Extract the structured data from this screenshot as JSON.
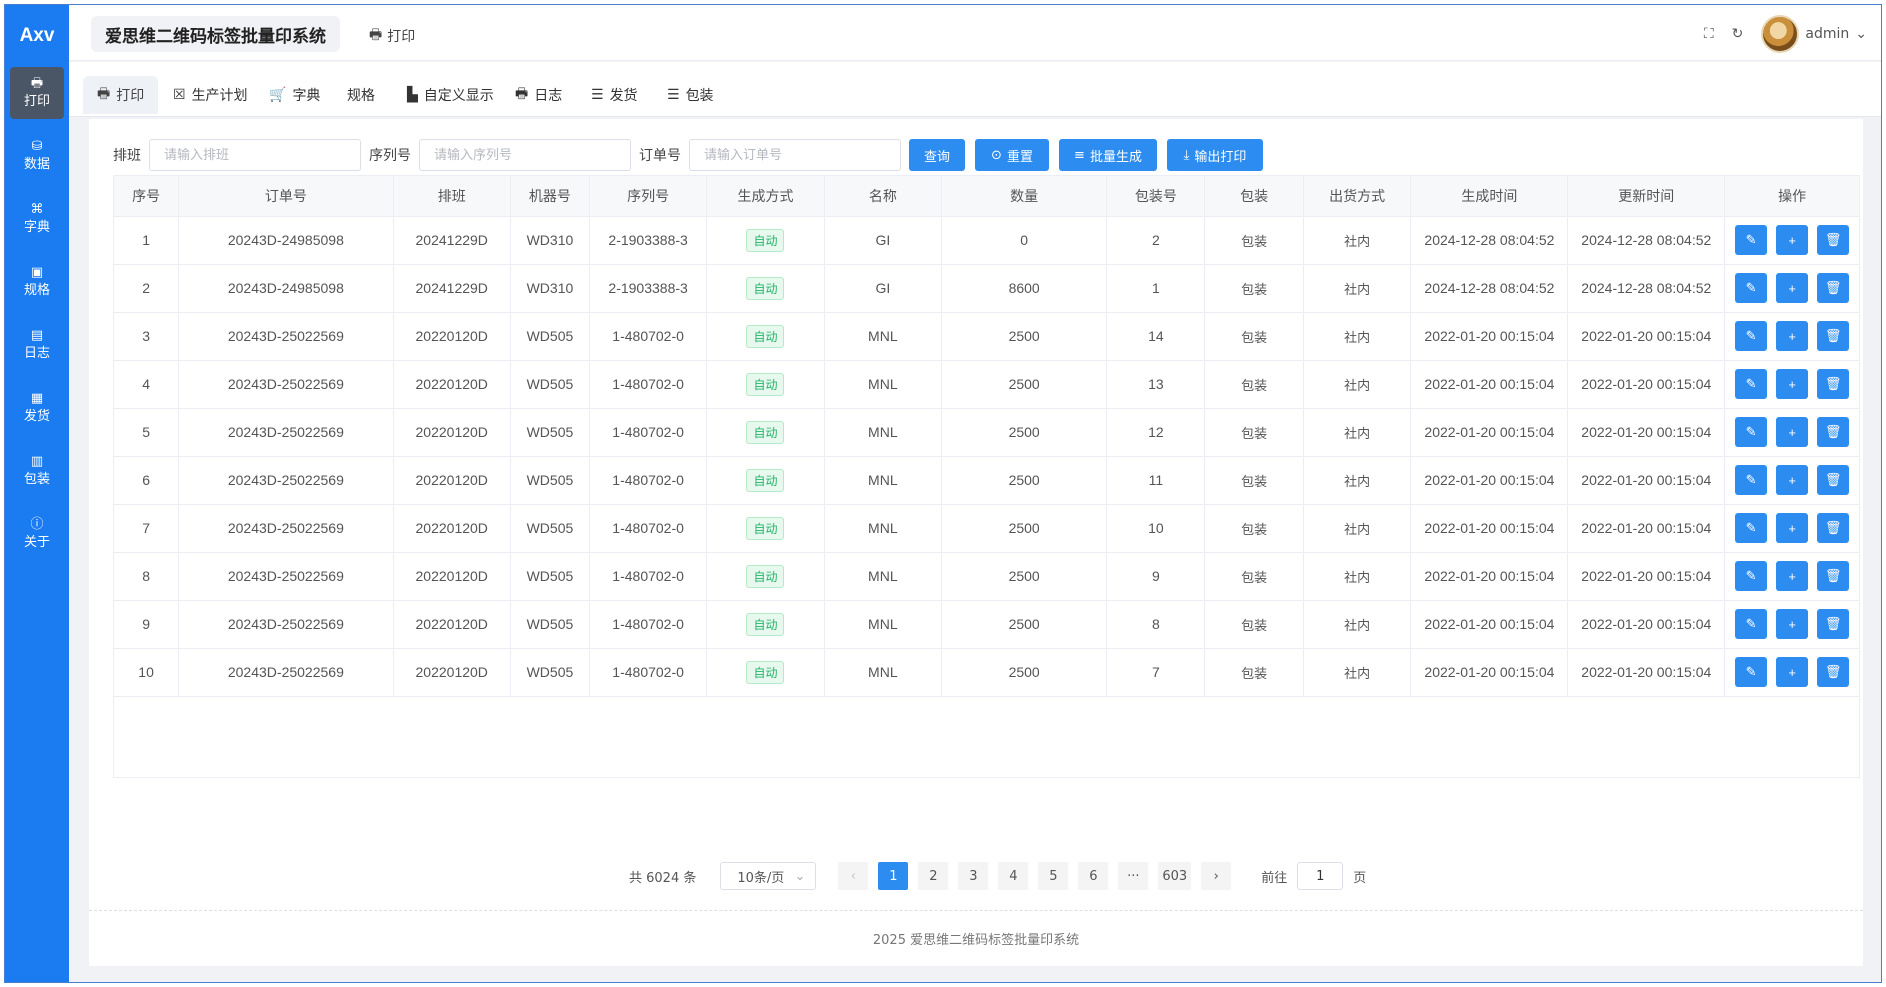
{
  "sidebar": {
    "logo": "Axv",
    "items": [
      {
        "icon": "🖶",
        "label": "打印"
      },
      {
        "icon": "⛁",
        "label": "数据"
      },
      {
        "icon": "⌘",
        "label": "字典"
      },
      {
        "icon": "▣",
        "label": "规格"
      },
      {
        "icon": "▤",
        "label": "日志"
      },
      {
        "icon": "▦",
        "label": "发货"
      },
      {
        "icon": "▥",
        "label": "包装"
      },
      {
        "icon": "ⓘ",
        "label": "关于"
      }
    ]
  },
  "header": {
    "title": "爱思维二维码标签批量印系统",
    "print_label": "打印",
    "print_icon": "🖶",
    "fullscreen_icon": "⛶",
    "refresh_icon": "↻",
    "user": "admin",
    "chevron": "⌄"
  },
  "tabs": [
    {
      "icon": "🖶",
      "label": "打印"
    },
    {
      "icon": "☒",
      "label": "生产计划"
    },
    {
      "icon": "🛒",
      "label": "字典"
    },
    {
      "icon": "",
      "label": "规格"
    },
    {
      "icon": "▙",
      "label": "自定义显示"
    },
    {
      "icon": "🖶",
      "label": "日志"
    },
    {
      "icon": "☰",
      "label": "发货"
    },
    {
      "icon": "☰",
      "label": "包装"
    }
  ],
  "search": {
    "shift_label": "排班",
    "shift_placeholder": "请输入排班",
    "serial_label": "序列号",
    "serial_placeholder": "请输入序列号",
    "order_label": "订单号",
    "order_placeholder": "请输入订单号",
    "query_btn": "查询",
    "reset_btn": "重置",
    "batch_btn": "批量生成",
    "export_btn": "输出打印",
    "reset_icon": "⊙",
    "batch_icon": "≡",
    "export_icon": "⤓"
  },
  "table": {
    "headers": [
      "序号",
      "订单号",
      "排班",
      "机器号",
      "序列号",
      "生成方式",
      "名称",
      "数量",
      "包装号",
      "包装",
      "出货方式",
      "生成时间",
      "更新时间",
      "操作"
    ],
    "rows": [
      [
        "1",
        "20243D-24985098",
        "20241229D",
        "WD310",
        "2-1903388-3",
        "自动",
        "GI",
        "0",
        "2",
        "包装",
        "社内",
        "2024-12-28 08:04:52",
        "2024-12-28 08:04:52"
      ],
      [
        "2",
        "20243D-24985098",
        "20241229D",
        "WD310",
        "2-1903388-3",
        "自动",
        "GI",
        "8600",
        "1",
        "包装",
        "社内",
        "2024-12-28 08:04:52",
        "2024-12-28 08:04:52"
      ],
      [
        "3",
        "20243D-25022569",
        "20220120D",
        "WD505",
        "1-480702-0",
        "自动",
        "MNL",
        "2500",
        "14",
        "包装",
        "社内",
        "2022-01-20 00:15:04",
        "2022-01-20 00:15:04"
      ],
      [
        "4",
        "20243D-25022569",
        "20220120D",
        "WD505",
        "1-480702-0",
        "自动",
        "MNL",
        "2500",
        "13",
        "包装",
        "社内",
        "2022-01-20 00:15:04",
        "2022-01-20 00:15:04"
      ],
      [
        "5",
        "20243D-25022569",
        "20220120D",
        "WD505",
        "1-480702-0",
        "自动",
        "MNL",
        "2500",
        "12",
        "包装",
        "社内",
        "2022-01-20 00:15:04",
        "2022-01-20 00:15:04"
      ],
      [
        "6",
        "20243D-25022569",
        "20220120D",
        "WD505",
        "1-480702-0",
        "自动",
        "MNL",
        "2500",
        "11",
        "包装",
        "社内",
        "2022-01-20 00:15:04",
        "2022-01-20 00:15:04"
      ],
      [
        "7",
        "20243D-25022569",
        "20220120D",
        "WD505",
        "1-480702-0",
        "自动",
        "MNL",
        "2500",
        "10",
        "包装",
        "社内",
        "2022-01-20 00:15:04",
        "2022-01-20 00:15:04"
      ],
      [
        "8",
        "20243D-25022569",
        "20220120D",
        "WD505",
        "1-480702-0",
        "自动",
        "MNL",
        "2500",
        "9",
        "包装",
        "社内",
        "2022-01-20 00:15:04",
        "2022-01-20 00:15:04"
      ],
      [
        "9",
        "20243D-25022569",
        "20220120D",
        "WD505",
        "1-480702-0",
        "自动",
        "MNL",
        "2500",
        "8",
        "包装",
        "社内",
        "2022-01-20 00:15:04",
        "2022-01-20 00:15:04"
      ],
      [
        "10",
        "20243D-25022569",
        "20220120D",
        "WD505",
        "1-480702-0",
        "自动",
        "MNL",
        "2500",
        "7",
        "包装",
        "社内",
        "2022-01-20 00:15:04",
        "2022-01-20 00:15:04"
      ]
    ],
    "op_icons": {
      "edit": "✎",
      "add": "+",
      "delete": "🗑"
    }
  },
  "pagination": {
    "total": "共 6024 条",
    "page_size": "10条/页",
    "prev": "‹",
    "next": "›",
    "pages": [
      "1",
      "2",
      "3",
      "4",
      "5",
      "6",
      "···",
      "603"
    ],
    "goto_label": "前往",
    "goto_value": "1",
    "page_suffix": "页"
  },
  "footer": "2025 爱思维二维码标签批量印系统",
  "colors": {
    "sidebar": "#1a7cf0",
    "primary": "#2d8cf0",
    "tag_green": "#27b36a"
  }
}
